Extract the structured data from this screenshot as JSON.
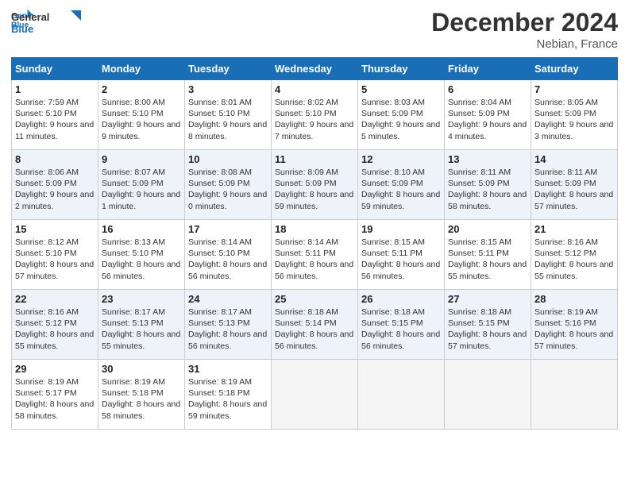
{
  "header": {
    "logo_line1": "General",
    "logo_line2": "Blue",
    "month": "December 2024",
    "location": "Nebian, France"
  },
  "weekdays": [
    "Sunday",
    "Monday",
    "Tuesday",
    "Wednesday",
    "Thursday",
    "Friday",
    "Saturday"
  ],
  "weeks": [
    [
      {
        "day": "1",
        "rise": "Sunrise: 7:59 AM",
        "set": "Sunset: 5:10 PM",
        "light": "Daylight: 9 hours and 11 minutes."
      },
      {
        "day": "2",
        "rise": "Sunrise: 8:00 AM",
        "set": "Sunset: 5:10 PM",
        "light": "Daylight: 9 hours and 9 minutes."
      },
      {
        "day": "3",
        "rise": "Sunrise: 8:01 AM",
        "set": "Sunset: 5:10 PM",
        "light": "Daylight: 9 hours and 8 minutes."
      },
      {
        "day": "4",
        "rise": "Sunrise: 8:02 AM",
        "set": "Sunset: 5:10 PM",
        "light": "Daylight: 9 hours and 7 minutes."
      },
      {
        "day": "5",
        "rise": "Sunrise: 8:03 AM",
        "set": "Sunset: 5:09 PM",
        "light": "Daylight: 9 hours and 5 minutes."
      },
      {
        "day": "6",
        "rise": "Sunrise: 8:04 AM",
        "set": "Sunset: 5:09 PM",
        "light": "Daylight: 9 hours and 4 minutes."
      },
      {
        "day": "7",
        "rise": "Sunrise: 8:05 AM",
        "set": "Sunset: 5:09 PM",
        "light": "Daylight: 9 hours and 3 minutes."
      }
    ],
    [
      {
        "day": "8",
        "rise": "Sunrise: 8:06 AM",
        "set": "Sunset: 5:09 PM",
        "light": "Daylight: 9 hours and 2 minutes."
      },
      {
        "day": "9",
        "rise": "Sunrise: 8:07 AM",
        "set": "Sunset: 5:09 PM",
        "light": "Daylight: 9 hours and 1 minute."
      },
      {
        "day": "10",
        "rise": "Sunrise: 8:08 AM",
        "set": "Sunset: 5:09 PM",
        "light": "Daylight: 9 hours and 0 minutes."
      },
      {
        "day": "11",
        "rise": "Sunrise: 8:09 AM",
        "set": "Sunset: 5:09 PM",
        "light": "Daylight: 8 hours and 59 minutes."
      },
      {
        "day": "12",
        "rise": "Sunrise: 8:10 AM",
        "set": "Sunset: 5:09 PM",
        "light": "Daylight: 8 hours and 59 minutes."
      },
      {
        "day": "13",
        "rise": "Sunrise: 8:11 AM",
        "set": "Sunset: 5:09 PM",
        "light": "Daylight: 8 hours and 58 minutes."
      },
      {
        "day": "14",
        "rise": "Sunrise: 8:11 AM",
        "set": "Sunset: 5:09 PM",
        "light": "Daylight: 8 hours and 57 minutes."
      }
    ],
    [
      {
        "day": "15",
        "rise": "Sunrise: 8:12 AM",
        "set": "Sunset: 5:10 PM",
        "light": "Daylight: 8 hours and 57 minutes."
      },
      {
        "day": "16",
        "rise": "Sunrise: 8:13 AM",
        "set": "Sunset: 5:10 PM",
        "light": "Daylight: 8 hours and 56 minutes."
      },
      {
        "day": "17",
        "rise": "Sunrise: 8:14 AM",
        "set": "Sunset: 5:10 PM",
        "light": "Daylight: 8 hours and 56 minutes."
      },
      {
        "day": "18",
        "rise": "Sunrise: 8:14 AM",
        "set": "Sunset: 5:11 PM",
        "light": "Daylight: 8 hours and 56 minutes."
      },
      {
        "day": "19",
        "rise": "Sunrise: 8:15 AM",
        "set": "Sunset: 5:11 PM",
        "light": "Daylight: 8 hours and 56 minutes."
      },
      {
        "day": "20",
        "rise": "Sunrise: 8:15 AM",
        "set": "Sunset: 5:11 PM",
        "light": "Daylight: 8 hours and 55 minutes."
      },
      {
        "day": "21",
        "rise": "Sunrise: 8:16 AM",
        "set": "Sunset: 5:12 PM",
        "light": "Daylight: 8 hours and 55 minutes."
      }
    ],
    [
      {
        "day": "22",
        "rise": "Sunrise: 8:16 AM",
        "set": "Sunset: 5:12 PM",
        "light": "Daylight: 8 hours and 55 minutes."
      },
      {
        "day": "23",
        "rise": "Sunrise: 8:17 AM",
        "set": "Sunset: 5:13 PM",
        "light": "Daylight: 8 hours and 55 minutes."
      },
      {
        "day": "24",
        "rise": "Sunrise: 8:17 AM",
        "set": "Sunset: 5:13 PM",
        "light": "Daylight: 8 hours and 56 minutes."
      },
      {
        "day": "25",
        "rise": "Sunrise: 8:18 AM",
        "set": "Sunset: 5:14 PM",
        "light": "Daylight: 8 hours and 56 minutes."
      },
      {
        "day": "26",
        "rise": "Sunrise: 8:18 AM",
        "set": "Sunset: 5:15 PM",
        "light": "Daylight: 8 hours and 56 minutes."
      },
      {
        "day": "27",
        "rise": "Sunrise: 8:18 AM",
        "set": "Sunset: 5:15 PM",
        "light": "Daylight: 8 hours and 57 minutes."
      },
      {
        "day": "28",
        "rise": "Sunrise: 8:19 AM",
        "set": "Sunset: 5:16 PM",
        "light": "Daylight: 8 hours and 57 minutes."
      }
    ],
    [
      {
        "day": "29",
        "rise": "Sunrise: 8:19 AM",
        "set": "Sunset: 5:17 PM",
        "light": "Daylight: 8 hours and 58 minutes."
      },
      {
        "day": "30",
        "rise": "Sunrise: 8:19 AM",
        "set": "Sunset: 5:18 PM",
        "light": "Daylight: 8 hours and 58 minutes."
      },
      {
        "day": "31",
        "rise": "Sunrise: 8:19 AM",
        "set": "Sunset: 5:18 PM",
        "light": "Daylight: 8 hours and 59 minutes."
      },
      null,
      null,
      null,
      null
    ]
  ]
}
